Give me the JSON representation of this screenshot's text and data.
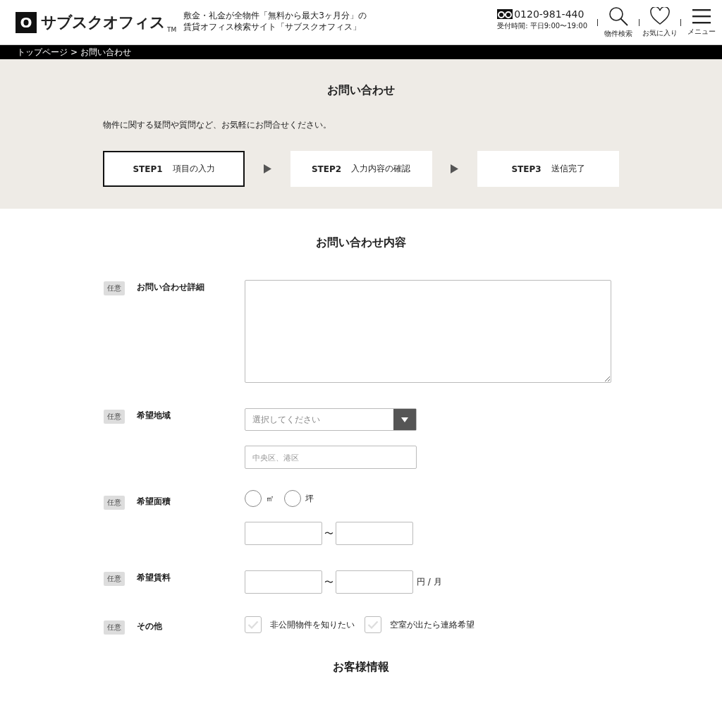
{
  "header": {
    "logo_mark": "O",
    "logo_text": "サブスクオフィス",
    "logo_tm": "TM",
    "tagline": [
      "敷金・礼金が全物件「無料から最大3ヶ月分」の",
      "賃貸オフィス検索サイト「サブスクオフィス」"
    ],
    "phone": "0120-981-440",
    "hours": "受付時間: 平日9:00〜19:00",
    "nav": [
      {
        "kind": "search",
        "label": "物件検索"
      },
      {
        "kind": "favorite",
        "label": "お気に入り"
      },
      {
        "kind": "menu",
        "label": "メニュー"
      }
    ]
  },
  "breadcrumb": {
    "items": [
      "トップページ",
      "お問い合わせ"
    ],
    "separator": ">"
  },
  "page_title": "お問い合わせ",
  "intro": "物件に関する疑問や質問など、お気軽にお問合せください。",
  "steps": [
    {
      "label": "STEP1",
      "text": "項目の入力",
      "selected": true
    },
    {
      "label": "STEP2",
      "text": "入力内容の確認",
      "selected": false
    },
    {
      "label": "STEP3",
      "text": "送信完了",
      "selected": false
    }
  ],
  "section_title": "お問い合わせ内容",
  "rows": [
    {
      "kind": "textarea",
      "badge": "任意",
      "label": "お問い合わせ詳細"
    },
    {
      "kind": "region",
      "badge": "任意",
      "label": "希望地域",
      "select_placeholder": "選択してください",
      "placeholder": "中央区、港区"
    },
    {
      "kind": "area",
      "badge": "任意",
      "label": "希望面積",
      "radios": [
        {
          "label": "㎡",
          "selected": false
        },
        {
          "label": "坪",
          "selected": false
        }
      ],
      "range_separator": "〜"
    },
    {
      "kind": "rent",
      "badge": "任意",
      "label": "希望賃料",
      "range_separator": "〜",
      "unit": "円 / 月"
    },
    {
      "kind": "options",
      "badge": "任意",
      "label": "その他",
      "checkboxes": [
        {
          "label": "非公開物件を知りたい",
          "checked": false
        },
        {
          "label": "空室が出たら連絡希望",
          "checked": false
        }
      ]
    }
  ],
  "customer_title": "お客様情報"
}
